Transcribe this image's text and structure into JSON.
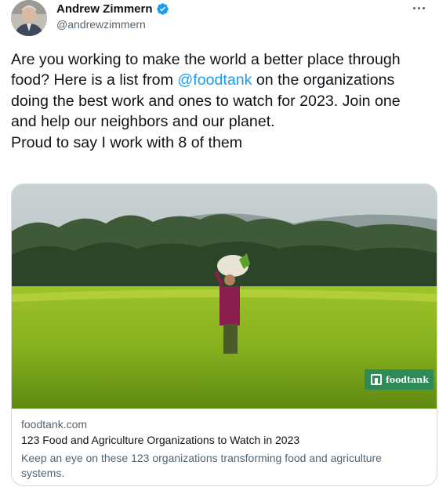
{
  "author": {
    "display_name": "Andrew Zimmern",
    "handle": "@andrewzimmern",
    "avatar_icon": "profile-photo",
    "verified_icon": "verified-badge-icon"
  },
  "tweet": {
    "text_before": "Are you working to make the world a better place through food? Here is a list from ",
    "mention": "@foodtank",
    "text_after": " on the organizations doing the best work and ones to watch for 2023. Join one and help our neighbors and our planet.\nProud to say I work with 8 of them"
  },
  "card": {
    "image_badge": "foodtank",
    "domain": "foodtank.com",
    "title": "123 Food and Agriculture Organizations to Watch in 2023",
    "description": "Keep an eye on these 123 organizations transforming food and agriculture systems."
  },
  "colors": {
    "link": "#1d9bf0",
    "secondary_text": "#536471",
    "verified": "#1d9bf0",
    "badge": "#2e8b57"
  }
}
